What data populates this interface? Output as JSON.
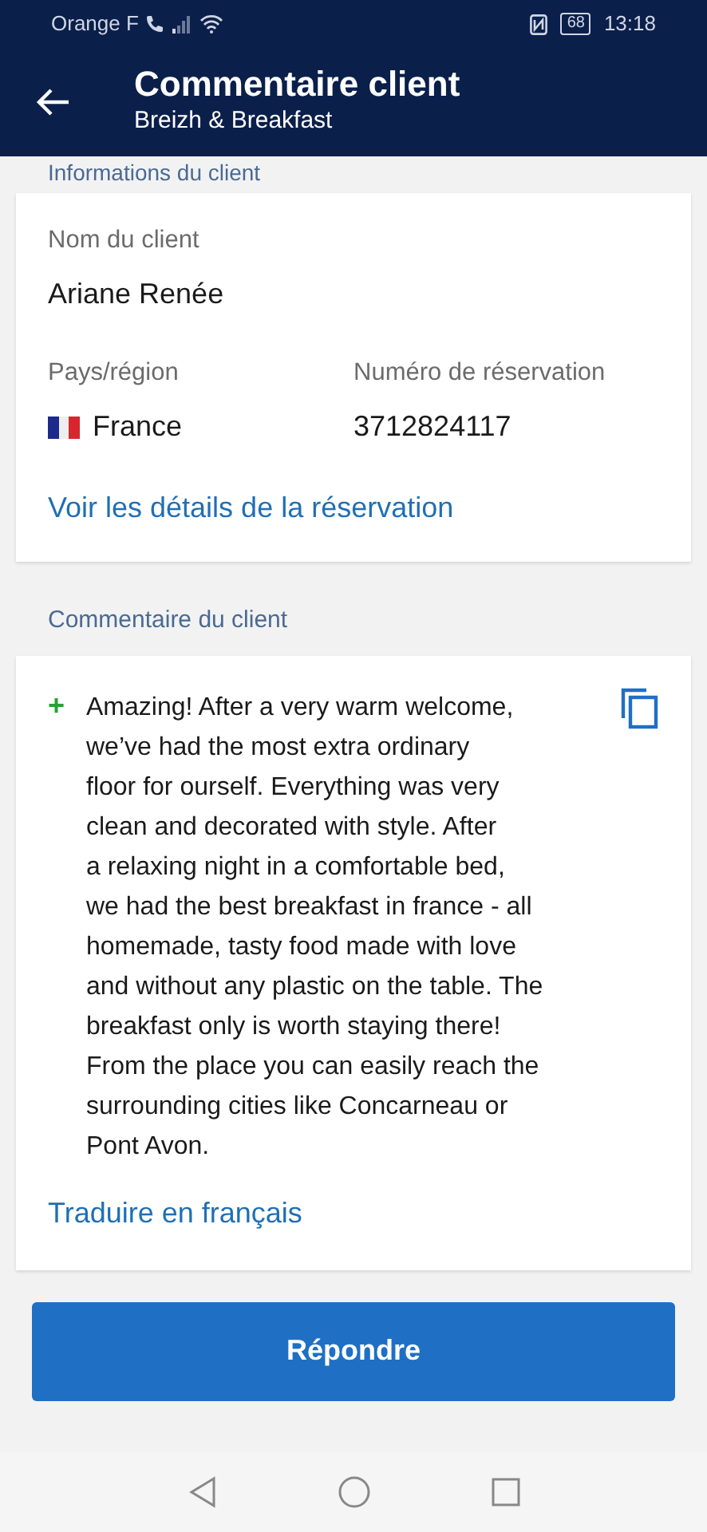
{
  "status_bar": {
    "carrier": "Orange F",
    "battery": "68",
    "time": "13:18"
  },
  "app_bar": {
    "title": "Commentaire client",
    "subtitle": "Breizh & Breakfast"
  },
  "client_info": {
    "section_title": "Informations du client",
    "name_label": "Nom du client",
    "name": "Ariane Renée",
    "country_label": "Pays/région",
    "country": "France",
    "booking_label": "Numéro de réservation",
    "booking_number": "3712824117",
    "details_link": "Voir les détails de la réservation"
  },
  "comment": {
    "section_title": "Commentaire du client",
    "marker": "+",
    "review_lines": [
      "Amazing! After a very warm welcome,",
      "we’ve had the most extra ordinary",
      "floor for ourself. Everything was very",
      "clean and decorated with style. After",
      "a relaxing night in a comfortable bed,",
      "we had the best breakfast in france - all",
      "homemade, tasty food made with love",
      "and without any plastic on the table. The",
      "breakfast only is worth staying there!",
      "From the place you can easily reach the",
      "surrounding cities like Concarneau or",
      "Pont Avon."
    ],
    "translate_link": "Traduire en français"
  },
  "reply_button": "Répondre"
}
